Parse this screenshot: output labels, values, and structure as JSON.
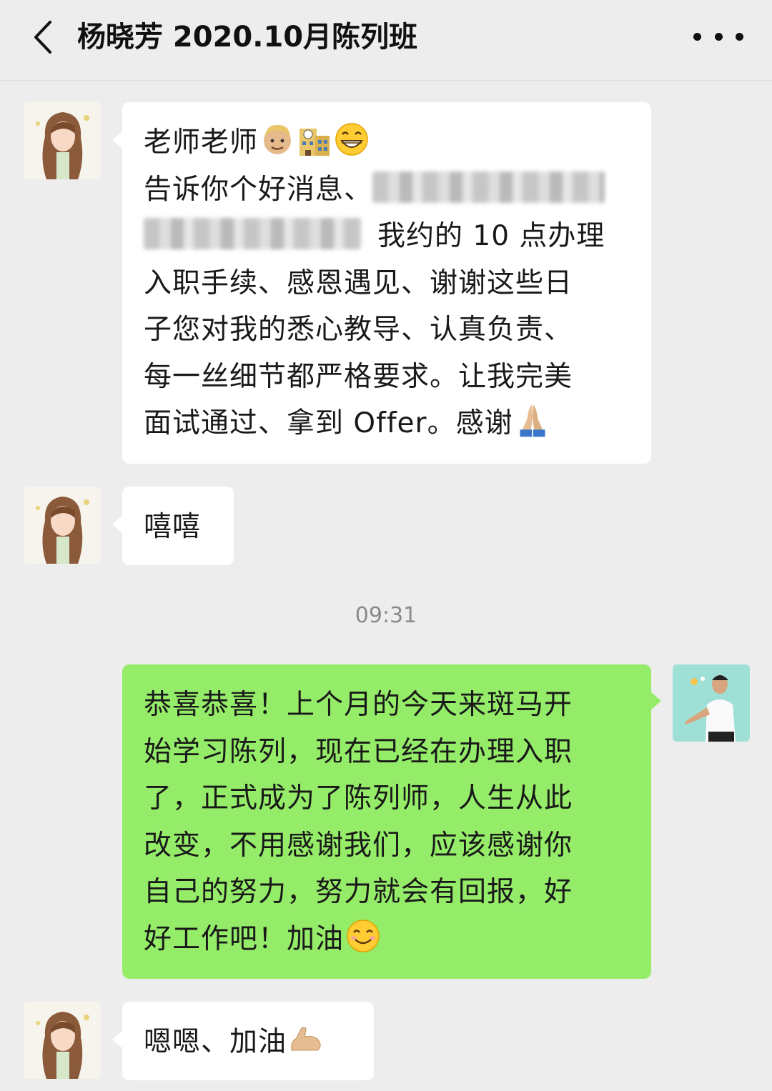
{
  "header": {
    "title": "杨晓芳 2020.10月陈列班",
    "back_icon": "chevron-left-icon",
    "more_icon": "more-horizontal-icon"
  },
  "messages": [
    {
      "sender": "student",
      "lines": [
        "老师老师",
        "告诉你个好消息、",
        "我约的 10 点办理",
        "入职手续、感恩遇见、谢谢这些日",
        "子您对我的悉心教导、认真负责、",
        "每一丝细节都严格要求。让我完美",
        "面试通过、拿到 Offer。感谢"
      ]
    },
    {
      "sender": "student",
      "text": "嘻嘻"
    },
    {
      "sender": "teacher",
      "lines": [
        "恭喜恭喜！上个月的今天来斑马开",
        "始学习陈列，现在已经在办理入职",
        "了，正式成为了陈列师，人生从此",
        "改变，不用感谢我们，应该感谢你",
        "自己的努力，努力就会有回报，好",
        "好工作吧！加油"
      ]
    },
    {
      "sender": "student",
      "text": "嗯嗯、加油"
    }
  ],
  "timestamp": "09:31",
  "colors": {
    "background": "#ededed",
    "incoming_bubble": "#ffffff",
    "outgoing_bubble": "#95ec69"
  }
}
